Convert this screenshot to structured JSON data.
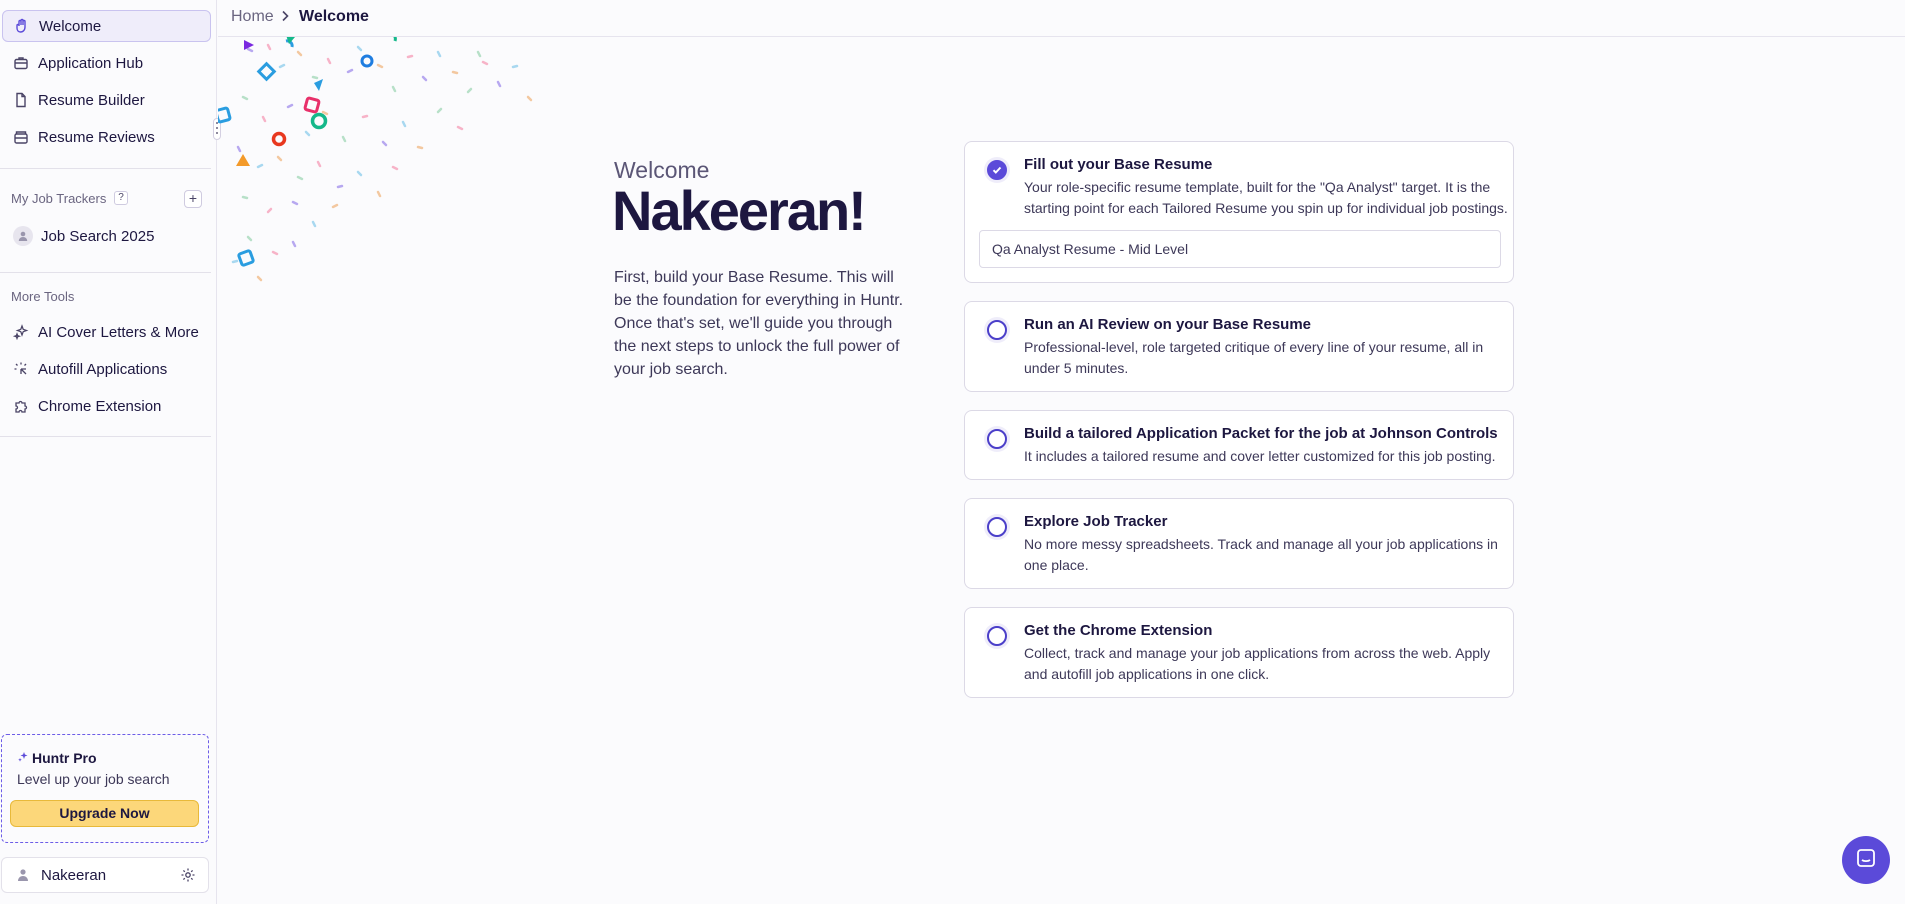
{
  "sidebar": {
    "nav": [
      {
        "label": "Welcome",
        "icon": "hand-icon"
      },
      {
        "label": "Application Hub",
        "icon": "briefcase-icon"
      },
      {
        "label": "Resume Builder",
        "icon": "document-icon"
      },
      {
        "label": "Resume Reviews",
        "icon": "inbox-icon"
      }
    ],
    "job_trackers_label": "My Job Trackers",
    "help_badge": "?",
    "add_tracker": "+",
    "trackers": [
      {
        "label": "Job Search 2025"
      }
    ],
    "more_tools_label": "More Tools",
    "tools": [
      {
        "label": "AI Cover Letters & More",
        "icon": "sparkles-icon"
      },
      {
        "label": "Autofill Applications",
        "icon": "autofill-icon"
      },
      {
        "label": "Chrome Extension",
        "icon": "puzzle-icon"
      }
    ],
    "pro": {
      "title": "Huntr Pro",
      "subtitle": "Level up your job search",
      "button": "Upgrade Now"
    },
    "user": {
      "name": "Nakeeran"
    }
  },
  "header": {
    "breadcrumb_home": "Home",
    "breadcrumb_current": "Welcome"
  },
  "main": {
    "welcome_label": "Welcome",
    "name": "Nakeeran!",
    "description": "First, build your Base Resume. This will be the foundation for everything in Huntr. Once that's set, we'll guide you through the next steps to unlock the full power of your job search.",
    "tasks": [
      {
        "title": "Fill out your Base Resume",
        "desc": "Your role-specific resume template, built for the \"Qa Analyst\" target. It is the starting point for each Tailored Resume you spin up for individual job postings.",
        "done": true,
        "resume_name": "Qa Analyst Resume - Mid Level"
      },
      {
        "title": "Run an AI Review on your Base Resume",
        "desc": "Professional-level, role targeted critique of every line of your resume, all in under 5 minutes.",
        "done": false
      },
      {
        "title": "Build a tailored Application Packet for the job at Johnson Controls",
        "desc": "It includes a tailored resume and cover letter customized for this job posting.",
        "done": false
      },
      {
        "title": "Explore Job Tracker",
        "desc": "No more messy spreadsheets. Track and manage all your job applications in one place.",
        "done": false
      },
      {
        "title": "Get the Chrome Extension",
        "desc": "Collect, track and manage your job applications from across the web. Apply and autofill job applications in one click.",
        "done": false
      }
    ]
  },
  "colors": {
    "accent": "#5b4ad9",
    "upgrade": "#fcd77a",
    "text": "#1d1740"
  }
}
